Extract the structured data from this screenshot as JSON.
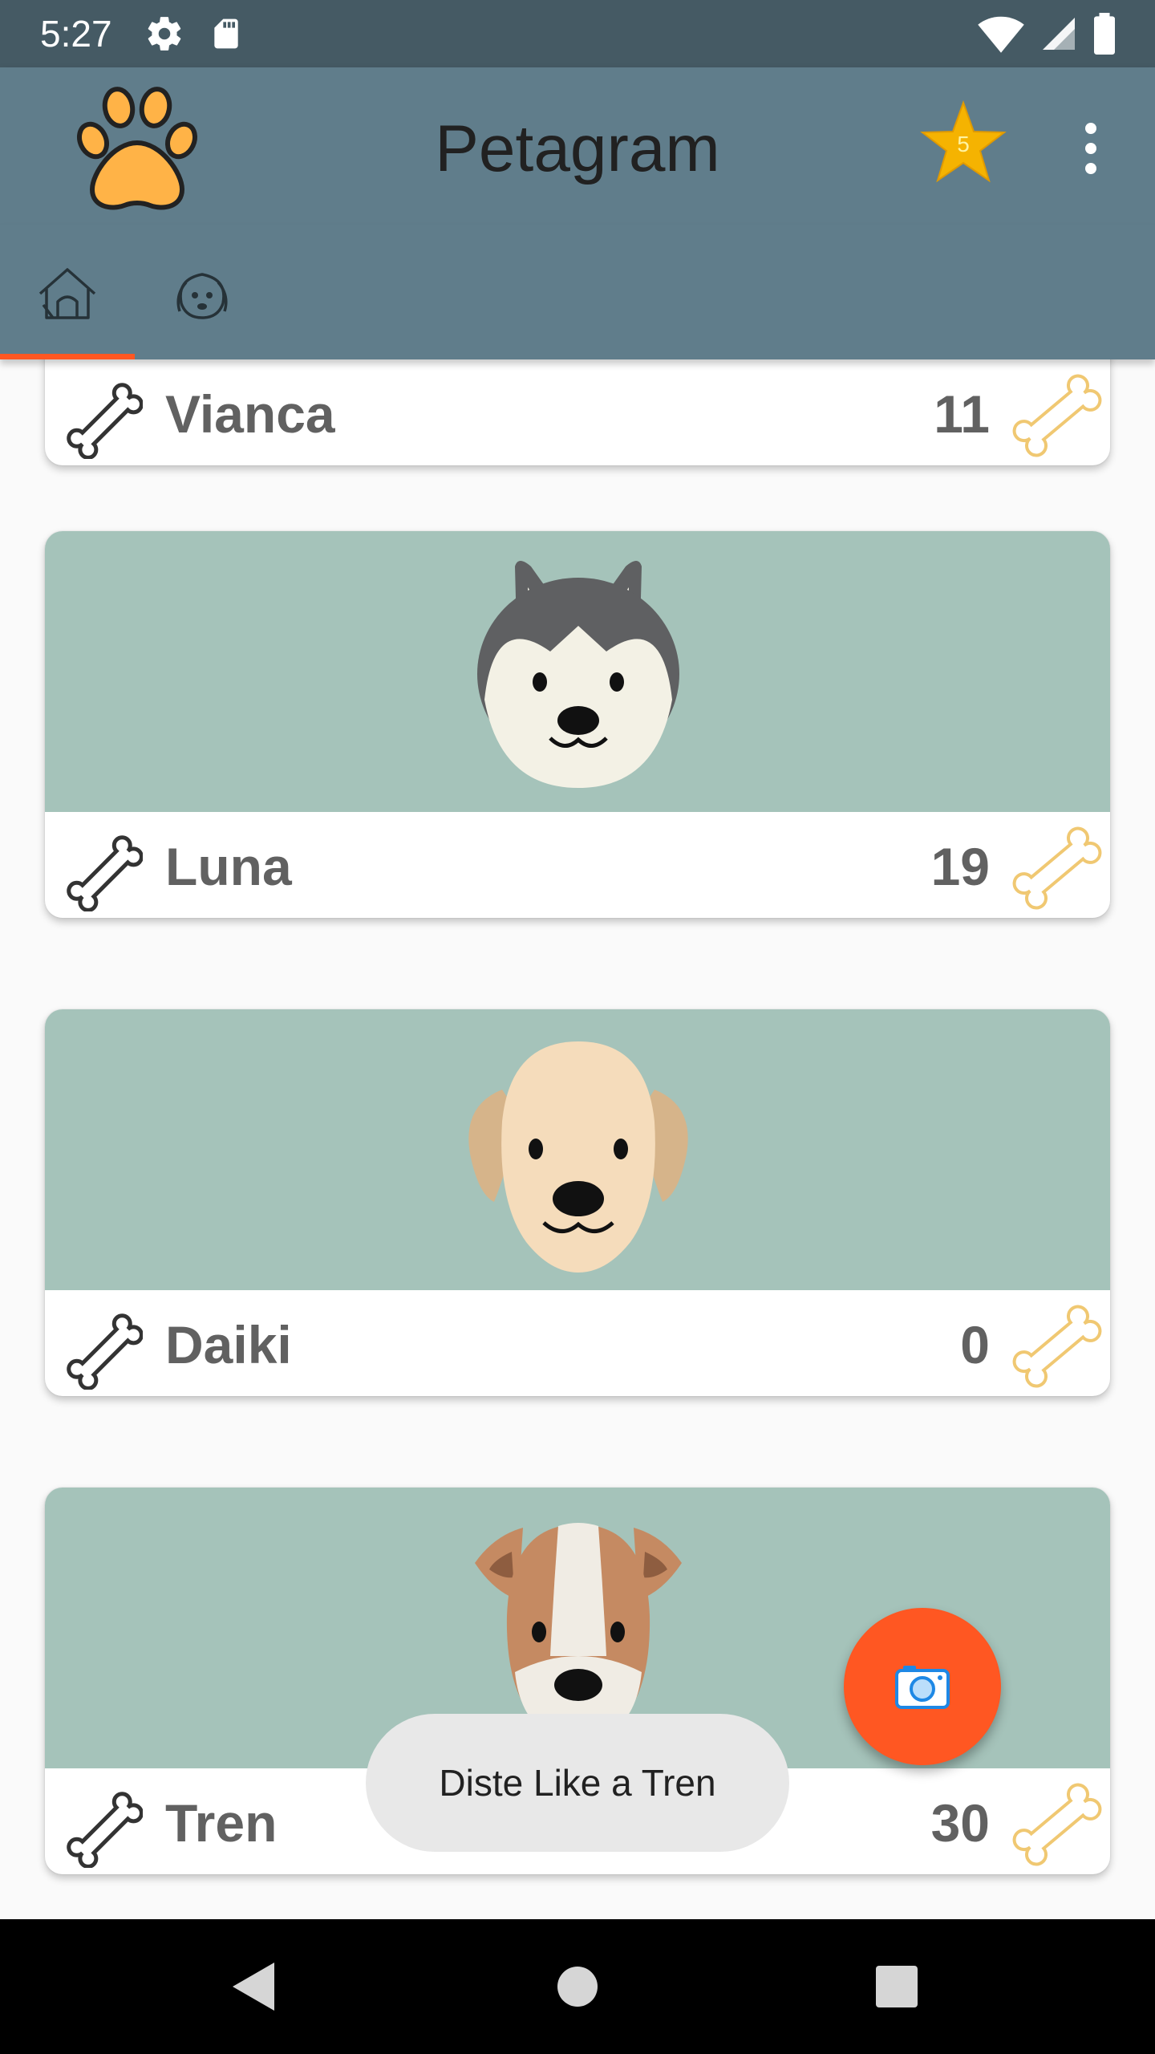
{
  "status_bar": {
    "time": "5:27"
  },
  "app_bar": {
    "title": "Petagram",
    "favorites_count": "5"
  },
  "tabs": [
    {
      "icon": "doghouse-icon",
      "selected": true
    },
    {
      "icon": "dog-face-icon",
      "selected": false
    }
  ],
  "pets": [
    {
      "name": "Vianca",
      "likes": "11"
    },
    {
      "name": "Luna",
      "likes": "19"
    },
    {
      "name": "Daiki",
      "likes": "0"
    },
    {
      "name": "Tren",
      "likes": "30"
    }
  ],
  "toast": {
    "text": "Diste Like a Tren"
  },
  "colors": {
    "status_bar": "#455a64",
    "primary": "#607d8b",
    "accent": "#ff5722",
    "card_image_bg": "#a5c3ba"
  }
}
